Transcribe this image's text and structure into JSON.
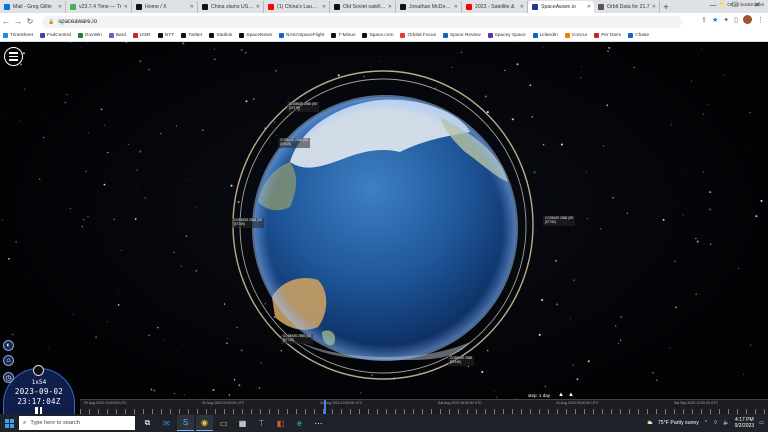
{
  "browser": {
    "tabs": [
      {
        "title": "Mail - Greg Gillin",
        "color": "#0078d4"
      },
      {
        "title": "v23.7.4 Time — Tr",
        "color": "#4caf50"
      },
      {
        "title": "Home / X",
        "color": "#111111"
      },
      {
        "title": "China slams US co",
        "color": "#111111"
      },
      {
        "title": "(1) China's Launch",
        "color": "#ff0000"
      },
      {
        "title": "Old Soviet satellite",
        "color": "#111111"
      },
      {
        "title": "Jonathan McDowell",
        "color": "#111111"
      },
      {
        "title": "2023 - Satellite &",
        "color": "#ff0000"
      },
      {
        "title": "SpaceAware.io",
        "color": "#1f3c88",
        "active": true
      },
      {
        "title": "Orbit Data for 21.7",
        "color": "#555555"
      }
    ],
    "new_tab": "+",
    "url": "spaceaware.io",
    "bookmarks": [
      {
        "label": "TimeSheet",
        "color": "#1e88e5"
      },
      {
        "label": "FedCentral",
        "color": "#3949ab"
      },
      {
        "label": "GovWin",
        "color": "#2e7d32"
      },
      {
        "label": "Bard",
        "color": "#7e57c2"
      },
      {
        "label": "I2SR",
        "color": "#c62828"
      },
      {
        "label": "NYT",
        "color": "#111111"
      },
      {
        "label": "Twitter",
        "color": "#111111"
      },
      {
        "label": "Starlink",
        "color": "#111111"
      },
      {
        "label": "SpaceNews",
        "color": "#111111"
      },
      {
        "label": "NASASpaceFlight",
        "color": "#1565c0"
      },
      {
        "label": "T-Minus",
        "color": "#111111"
      },
      {
        "label": "Space.com",
        "color": "#111111"
      },
      {
        "label": "Orbital Focus",
        "color": "#e53935"
      },
      {
        "label": "Space Review",
        "color": "#1565c0"
      },
      {
        "label": "Spacey Space",
        "color": "#5e35b1"
      },
      {
        "label": "LinkedIn",
        "color": "#0a66c2"
      },
      {
        "label": "Concur",
        "color": "#f57c00"
      },
      {
        "label": "Per Diem",
        "color": "#c62828"
      },
      {
        "label": "Chase",
        "color": "#1565c0"
      }
    ],
    "other_bookmarks": "Other bookmarks"
  },
  "viewer": {
    "sat_labels": [
      {
        "l1": "COSMOS 2565 (SE",
        "l2": "[57379]"
      },
      {
        "l1": "COSMOS 2566 (SE",
        "l2": "[57519]"
      },
      {
        "l1": "COSMOS 2568 (SE",
        "l2": "[57750]"
      },
      {
        "l1": "COSMOS 2568 (SE",
        "l2": "[57749]"
      },
      {
        "l1": "COSMOS 2565 (SE",
        "l2": "[57748]"
      },
      {
        "l1": "COSMOS 2565",
        "l2": "[57349]"
      }
    ],
    "time": {
      "speed": "1x54",
      "date": "2023-09-02",
      "clock": "23:17:04Z"
    },
    "step_label": "step: 1 day",
    "timeline_labels": [
      "Fri Aug 2023 19:00:00 UTC",
      "30 Aug 2023 00:00:00 UTC",
      "30 Aug 2023 12:00:00 UTC",
      "Sat Aug 2023 06:00:00 UTC",
      "31 Aug 2023 00:00:00 UTC",
      "Sat Sep 2023 12:00:00 UTC"
    ]
  },
  "taskbar": {
    "search_placeholder": "Type here to search",
    "weather": "75°F  Partly sunny",
    "clock_time": "4:17 PM",
    "clock_date": "9/2/2023"
  }
}
